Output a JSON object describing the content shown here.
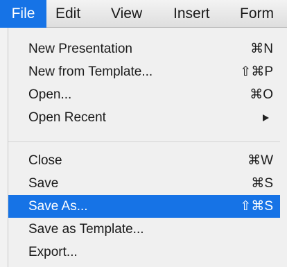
{
  "menubar": {
    "items": [
      "File",
      "Edit",
      "View",
      "Insert",
      "Form"
    ]
  },
  "file_menu": {
    "items": [
      {
        "label": "New Presentation",
        "shortcut": "⌘N"
      },
      {
        "label": "New from Template...",
        "shortcut": "⇧⌘P"
      },
      {
        "label": "Open...",
        "shortcut": "⌘O"
      },
      {
        "label": "Open Recent",
        "submenu": true
      },
      {
        "label": "Close",
        "shortcut": "⌘W"
      },
      {
        "label": "Save",
        "shortcut": "⌘S"
      },
      {
        "label": "Save As...",
        "shortcut": "⇧⌘S",
        "highlighted": true
      },
      {
        "label": "Save as Template..."
      },
      {
        "label": "Export..."
      }
    ]
  },
  "colors": {
    "highlight": "#1673e6",
    "menu_background": "#f0f0f0"
  }
}
